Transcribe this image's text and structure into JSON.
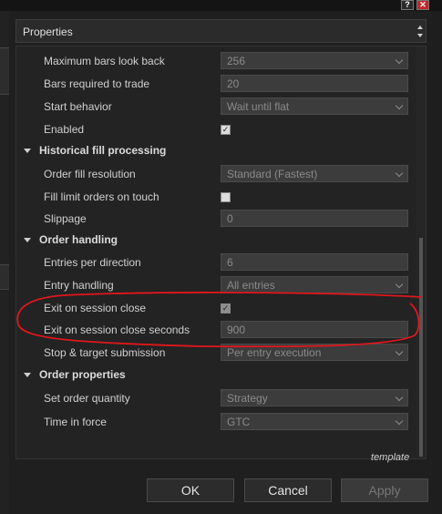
{
  "window": {
    "help_glyph": "?",
    "close_glyph": "✕"
  },
  "header": {
    "title": "Properties"
  },
  "rows": {
    "max_bars": {
      "label": "Maximum bars look back",
      "value": "256"
    },
    "bars_required": {
      "label": "Bars required to trade",
      "value": "20"
    },
    "start_behavior": {
      "label": "Start behavior",
      "value": "Wait until flat"
    },
    "enabled": {
      "label": "Enabled",
      "checked": true,
      "mark": "✓"
    },
    "cat_historical": {
      "label": "Historical fill processing"
    },
    "order_fill_res": {
      "label": "Order fill resolution",
      "value": "Standard (Fastest)"
    },
    "fill_limit": {
      "label": "Fill limit orders on touch",
      "checked": false,
      "mark": ""
    },
    "slippage": {
      "label": "Slippage",
      "value": "0"
    },
    "cat_order_handling": {
      "label": "Order handling"
    },
    "entries_per_dir": {
      "label": "Entries per direction",
      "value": "6"
    },
    "entry_handling": {
      "label": "Entry handling",
      "value": "All entries"
    },
    "exit_on_close": {
      "label": "Exit on session close",
      "checked": true,
      "mark": "✓"
    },
    "exit_close_seconds": {
      "label": "Exit on session close seconds",
      "value": "900"
    },
    "stop_target": {
      "label": "Stop & target submission",
      "value": "Per entry execution"
    },
    "cat_order_props": {
      "label": "Order properties"
    },
    "order_qty": {
      "label": "Set order quantity",
      "value": "Strategy"
    },
    "time_in_force": {
      "label": "Time in force",
      "value": "GTC"
    }
  },
  "template_label": "template",
  "buttons": {
    "ok": "OK",
    "cancel": "Cancel",
    "apply": "Apply"
  },
  "colors": {
    "background": "#1b1b1b",
    "panel": "#1f1f1f",
    "annotation_red": "#e0161c",
    "close_button": "#c0282a"
  }
}
